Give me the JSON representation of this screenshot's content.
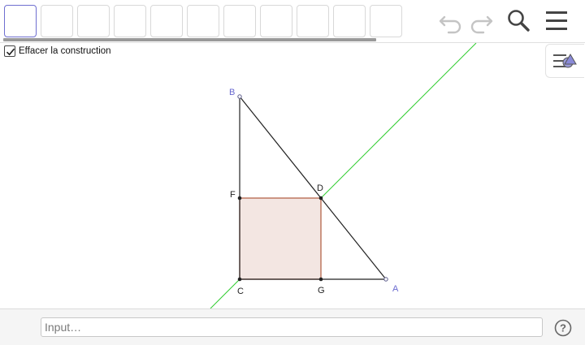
{
  "toolbar": {
    "tool_count": 11,
    "selected_tool_index": 0,
    "icons": [
      "undo-icon",
      "redo-icon",
      "search-icon",
      "menu-icon"
    ]
  },
  "construction": {
    "checkbox_label": "Effacer la construction",
    "checked": true
  },
  "graphics": {
    "points": [
      {
        "name": "B"
      },
      {
        "name": "F"
      },
      {
        "name": "D"
      },
      {
        "name": "C"
      },
      {
        "name": "G"
      },
      {
        "name": "A"
      }
    ],
    "colors": {
      "line": "#2ecc2e",
      "square_fill": "#f3e6e2",
      "square_stroke": "#b5654a",
      "label_blue": "#6a6ad0"
    }
  },
  "input_bar": {
    "placeholder": "Input…"
  },
  "help": {
    "glyph": "?"
  }
}
